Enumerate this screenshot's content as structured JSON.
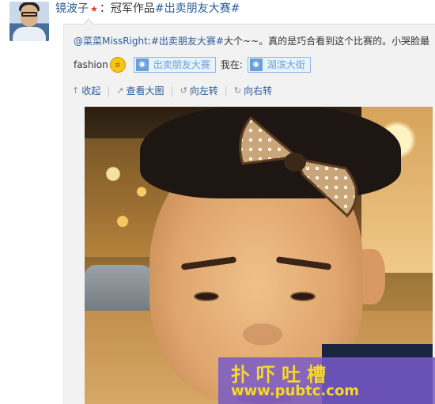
{
  "post": {
    "author": "镜波子",
    "vip_badge": "★",
    "colon": "：",
    "text": "冠军作品",
    "topic": "#出卖朋友大赛#"
  },
  "repost": {
    "mention": "@菜菜MissRight",
    "colon": ":",
    "topic": "#出卖朋友大赛#",
    "text1": "大个~~。真的是巧合看到这个比赛的。小哭脸最",
    "text2": "fashion",
    "emoji": "ಠ",
    "location_chip1": "出卖朋友大赛",
    "at_label": "我在:",
    "location_chip2": "湖滨大街"
  },
  "actions": {
    "collapse": "收起",
    "view_large": "查看大图",
    "rotate_left": "向左转",
    "rotate_right": "向右转",
    "icons": {
      "collapse": "↑",
      "view_large": "↗",
      "rotate_left": "↺",
      "rotate_right": "↻"
    }
  },
  "watermark": {
    "title": "扑吓吐槽",
    "url": "www.pubtc.com"
  },
  "colors": {
    "link": "#2b5c9a",
    "chip_border": "#8fb7e0",
    "watermark_bg": "#785ac8",
    "watermark_text": "#f6d72a"
  }
}
